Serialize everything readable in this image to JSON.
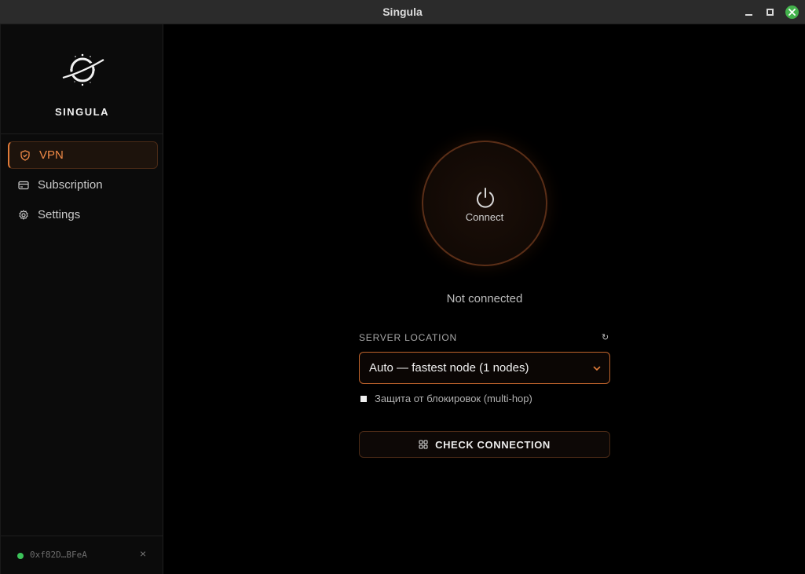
{
  "window": {
    "title": "Singula"
  },
  "sidebar": {
    "brand": "SINGULA",
    "items": [
      {
        "label": "VPN",
        "icon": "shield-icon",
        "active": true
      },
      {
        "label": "Subscription",
        "icon": "card-icon",
        "active": false
      },
      {
        "label": "Settings",
        "icon": "gear-icon",
        "active": false
      }
    ],
    "wallet": {
      "address": "0xf82D…BFeA",
      "status_color": "#3cc35a"
    }
  },
  "main": {
    "connect_label": "Connect",
    "status": "Not connected",
    "server_location_label": "SERVER LOCATION",
    "refresh_symbol": "↻",
    "server_selected": "Auto — fastest node (1 nodes)",
    "multihop_label": "Защита от блокировок (multi-hop)",
    "check_button": "CHECK CONNECTION"
  },
  "colors": {
    "accent": "#e07b39",
    "background": "#000000",
    "sidebar": "#0b0b0b"
  }
}
